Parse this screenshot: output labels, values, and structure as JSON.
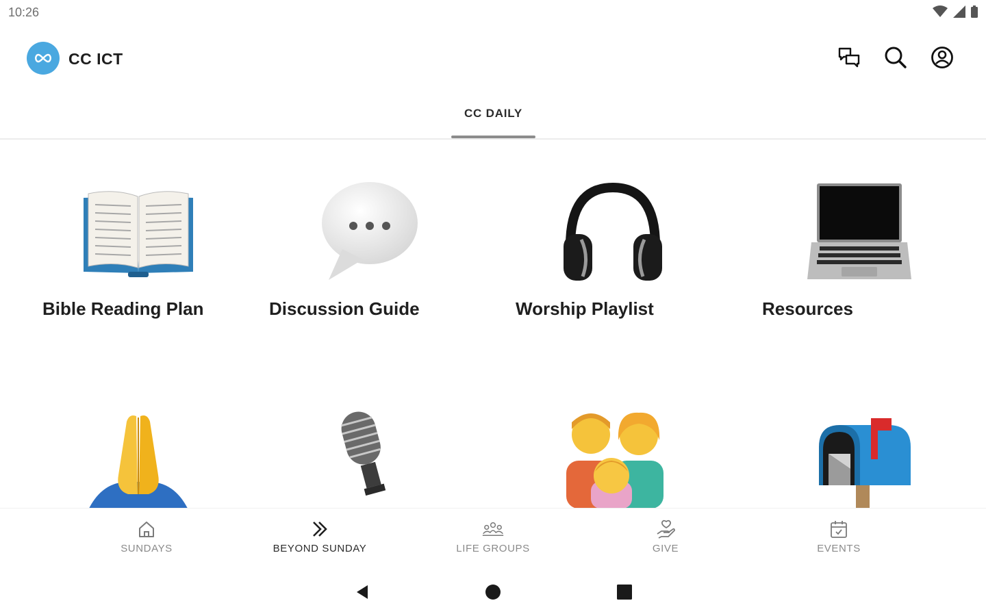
{
  "status_bar": {
    "time": "10:26"
  },
  "app": {
    "title": "CC ICT"
  },
  "tabs": [
    {
      "label": "CC DAILY"
    }
  ],
  "tiles": [
    {
      "label": "Bible Reading Plan",
      "icon": "open-book-icon"
    },
    {
      "label": "Discussion Guide",
      "icon": "speech-bubble-icon"
    },
    {
      "label": "Worship Playlist",
      "icon": "headphones-icon"
    },
    {
      "label": "Resources",
      "icon": "laptop-icon"
    },
    {
      "label": "",
      "icon": "praying-hands-icon"
    },
    {
      "label": "",
      "icon": "microphone-icon"
    },
    {
      "label": "",
      "icon": "family-icon"
    },
    {
      "label": "",
      "icon": "mailbox-icon"
    }
  ],
  "bottom_nav": [
    {
      "label": "SUNDAYS",
      "icon": "home-icon"
    },
    {
      "label": "BEYOND SUNDAY",
      "icon": "double-chevron-icon"
    },
    {
      "label": "LIFE GROUPS",
      "icon": "group-icon"
    },
    {
      "label": "GIVE",
      "icon": "give-hand-icon"
    },
    {
      "label": "EVENTS",
      "icon": "calendar-icon"
    }
  ],
  "colors": {
    "brand": "#4aa8e0",
    "active_text": "#2b2b2b",
    "inactive_text": "#8a8a8a"
  }
}
